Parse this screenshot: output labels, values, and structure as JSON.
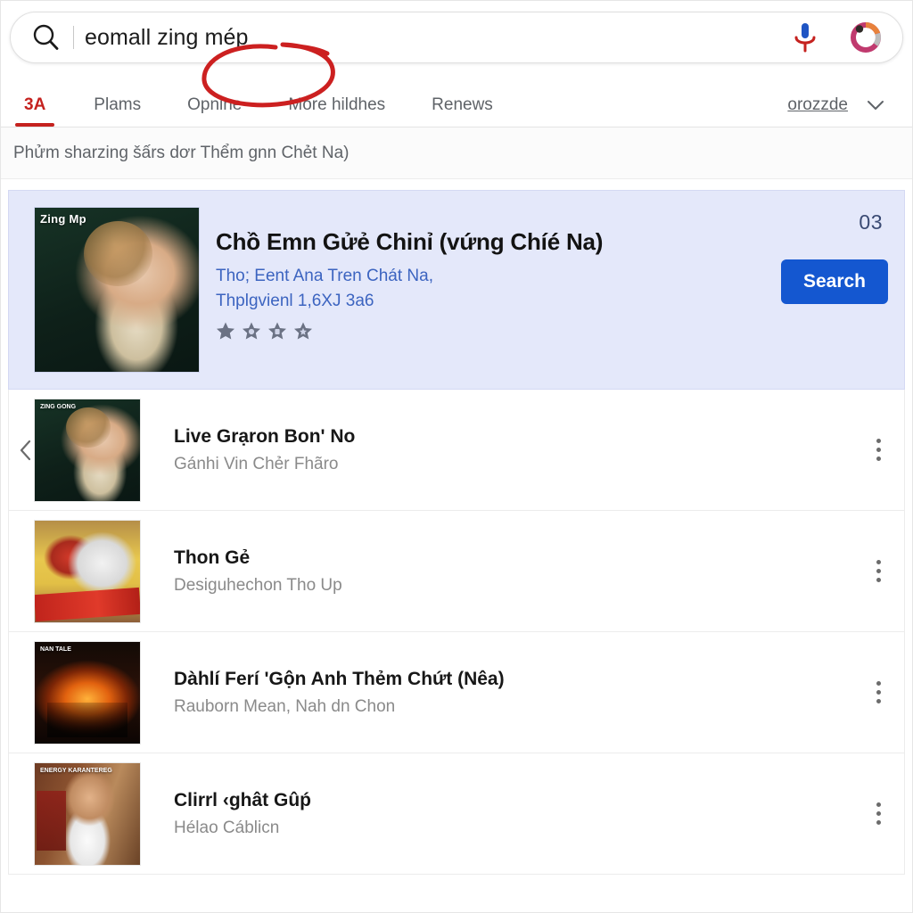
{
  "search": {
    "query": "eomall zing mép",
    "search_icon": "search-icon",
    "mic_icon": "microphone-icon",
    "lens_icon": "google-lens-icon"
  },
  "tabs": {
    "items": [
      {
        "label": "3A",
        "active": true
      },
      {
        "label": "Plams",
        "active": false
      },
      {
        "label": "Opnine",
        "active": false,
        "annotated": true
      },
      {
        "label": "More hildhes",
        "active": false
      },
      {
        "label": "Renews",
        "active": false
      }
    ],
    "account_link": "orozzde",
    "chevron_icon": "chevron-down-icon",
    "active_color": "#c5221f",
    "annotation_color": "#cc2020"
  },
  "subtitle": {
    "text": "Phửm sharzing šấrs dơr Thểm gnn Chẻt Na)"
  },
  "featured": {
    "thumb_label": "Zing Mp",
    "title": "Chồ Emn Gửẻ Chinỉ (vứng Chíé Na)",
    "subtitle_line1": "Tho; Eent Ana Tren Chát Na,",
    "subtitle_line2": "Thplgvienl 1,6XJ 3a6",
    "stars": 4,
    "badge_count": "03",
    "search_button": "Search",
    "background_color": "#e4e8fa",
    "button_color": "#1457d0",
    "link_color": "#3c64c0"
  },
  "results": {
    "prev_icon": "chevron-left-icon",
    "menu_icon": "more-vertical-icon",
    "rows": [
      {
        "title": "Live Grạron Bon' No",
        "subtitle": "Gánhi Vin Chẻr Fhãro",
        "thumb_label": "ZING GONG",
        "art": "art-green"
      },
      {
        "title": "Thon Gẻ",
        "subtitle": "Desiguhechon Tho Up",
        "thumb_label": "",
        "art": "art-toy"
      },
      {
        "title": "Dàhlí Ferí 'Gộn Anh Thẻm Chứt (Nêa)",
        "subtitle": "Rauborn Mean, Nah dn Chon",
        "thumb_label": "NAN TALE",
        "art": "art-fire"
      },
      {
        "title": "Clirrl ‹ghât Gûṕ",
        "subtitle": "Hélao Cáblicn",
        "thumb_label": "ENERGY KARANTEREG",
        "art": "art-office"
      }
    ]
  }
}
